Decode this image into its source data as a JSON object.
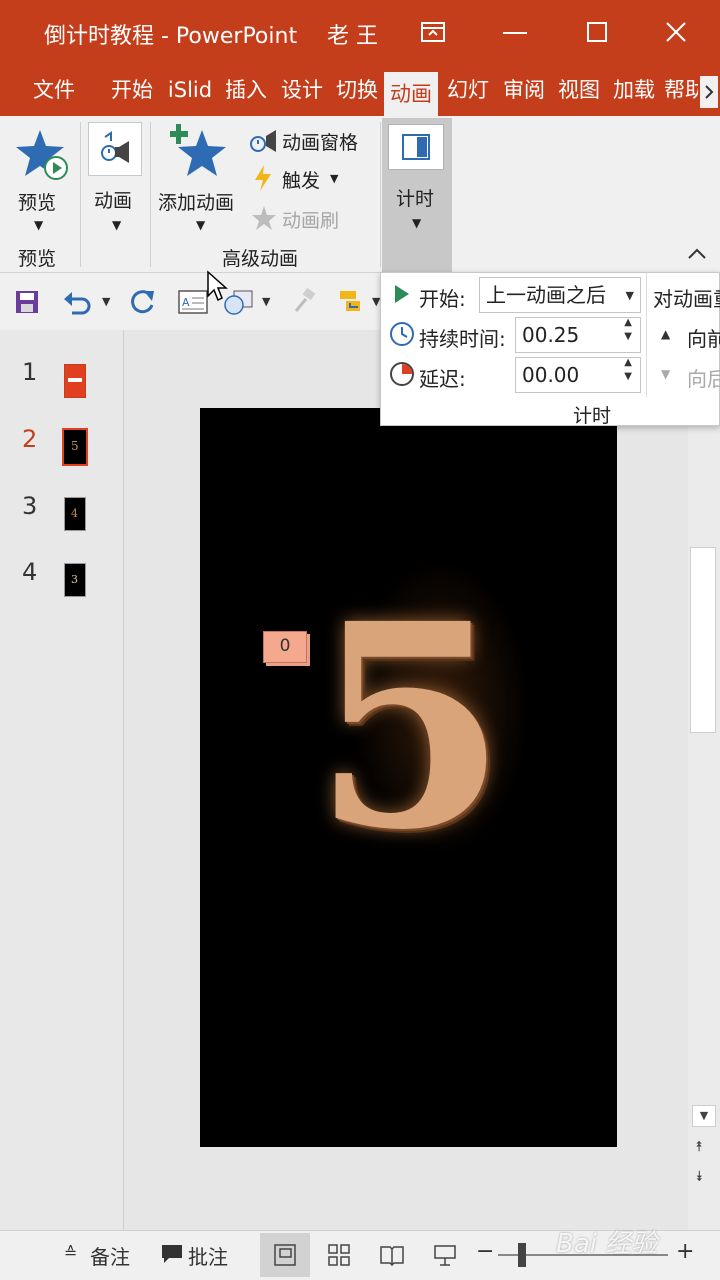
{
  "window": {
    "title": "倒计时教程 - PowerPoint",
    "user": "老 王",
    "colors": {
      "accent": "#c43e1c",
      "ribbon_bg": "#f0f0f0",
      "active_tab_text": "#c43e1c"
    }
  },
  "menu": {
    "tabs": [
      "文件",
      "开始",
      "iSlid",
      "插入",
      "设计",
      "切换",
      "动画",
      "幻灯",
      "审阅",
      "视图",
      "加载",
      "帮助"
    ],
    "active_tab": "动画"
  },
  "ribbon": {
    "preview_label": "预览",
    "preview_group": "预览",
    "animation_label": "动画",
    "add_animation_label": "添加动画",
    "animation_pane": "动画窗格",
    "trigger": "触发",
    "animation_painter": "动画刷",
    "advanced_group": "高级动画",
    "timing_label": "计时"
  },
  "timing_popup": {
    "start_label": "开始:",
    "start_value": "上一动画之后",
    "duration_label": "持续时间:",
    "duration_value": "00.25",
    "delay_label": "延迟:",
    "delay_value": "00.00",
    "group_label": "计时",
    "reorder_label": "对动画重",
    "move_earlier": "向前",
    "move_later": "向后"
  },
  "slides": {
    "numbers": [
      "1",
      "2",
      "3",
      "4"
    ],
    "selected": "2",
    "thumb_glyphs": [
      "",
      "5",
      "4",
      "3"
    ]
  },
  "slide": {
    "animation_tag": "0",
    "big_number": "5"
  },
  "status": {
    "notes": "备注",
    "comments": "批注",
    "watermark": "Bai 经验"
  }
}
